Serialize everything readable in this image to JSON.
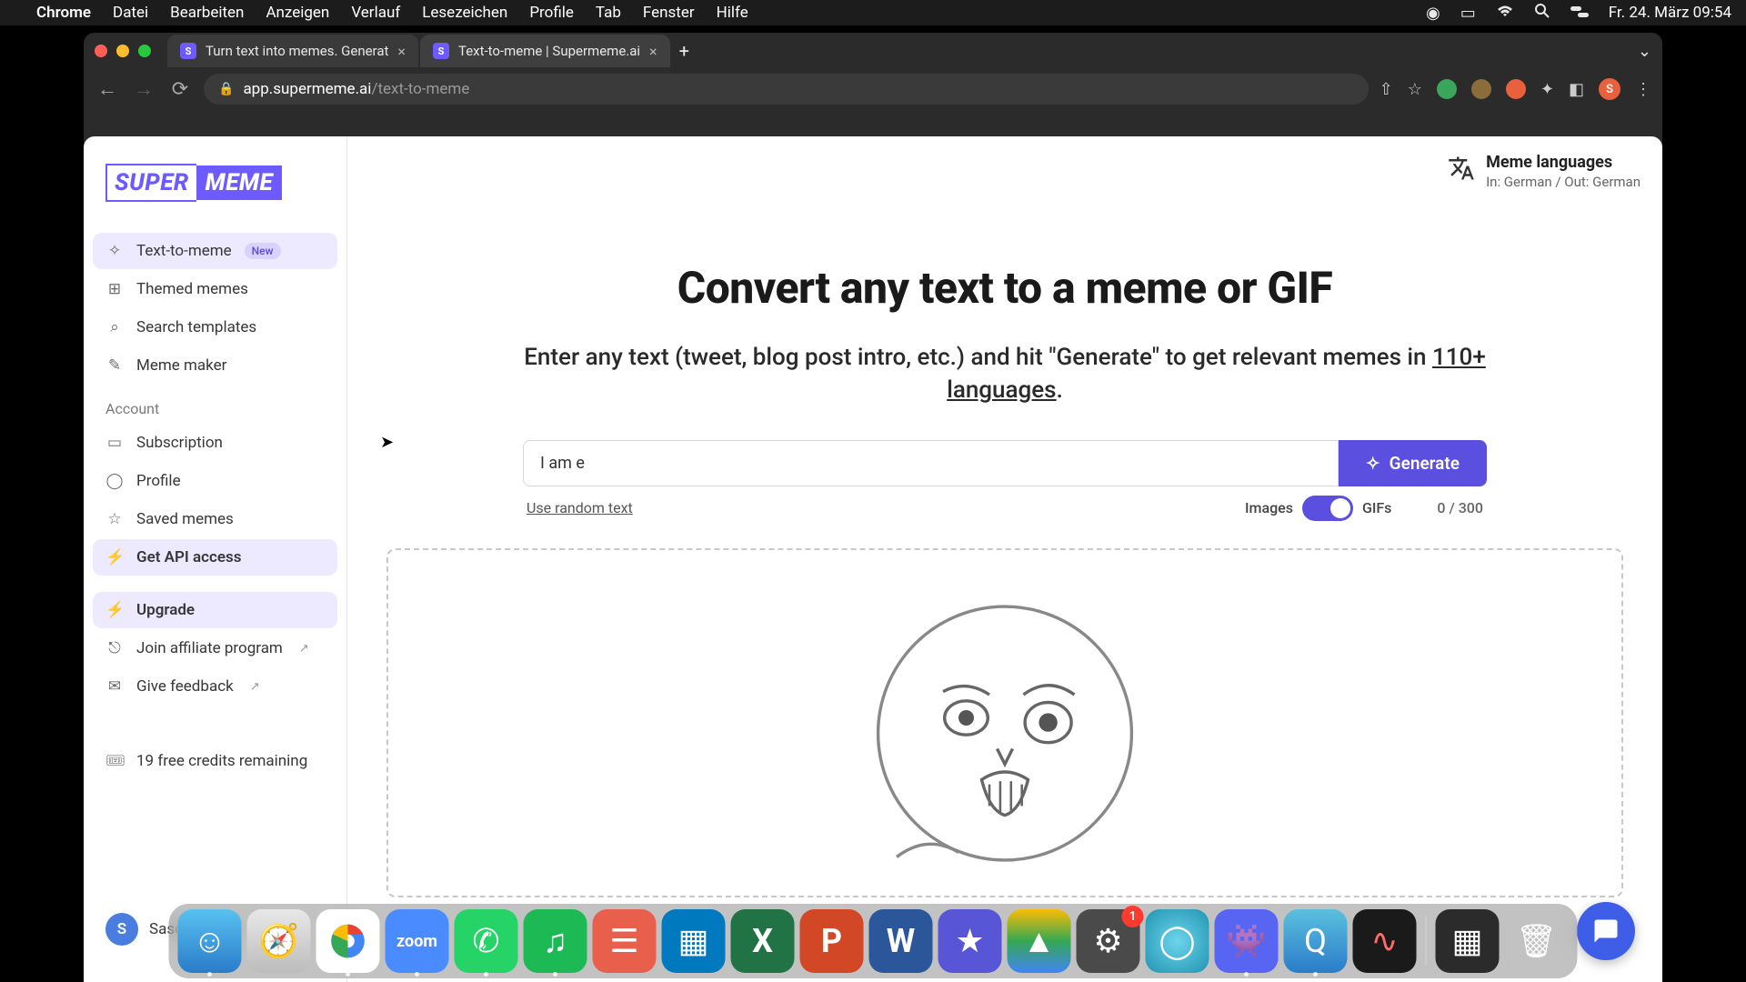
{
  "menubar": {
    "app": "Chrome",
    "items": [
      "Datei",
      "Bearbeiten",
      "Anzeigen",
      "Verlauf",
      "Lesezeichen",
      "Profile",
      "Tab",
      "Fenster",
      "Hilfe"
    ],
    "clock": "Fr. 24. März  09:54"
  },
  "browser": {
    "tabs": [
      {
        "title": "Turn text into memes. Generat",
        "favicon": "S"
      },
      {
        "title": "Text-to-meme | Supermeme.ai",
        "favicon": "S"
      }
    ],
    "url_domain": "app.supermeme.ai",
    "url_path": "/text-to-meme",
    "avatar_letter": "S"
  },
  "logo": {
    "left": "SUPER",
    "right": "MEME"
  },
  "sidebar": {
    "nav": [
      {
        "label": "Text-to-meme",
        "badge": "New",
        "active": true
      },
      {
        "label": "Themed memes"
      },
      {
        "label": "Search templates"
      },
      {
        "label": "Meme maker"
      }
    ],
    "account_label": "Account",
    "account": [
      {
        "label": "Subscription"
      },
      {
        "label": "Profile"
      },
      {
        "label": "Saved memes"
      },
      {
        "label": "Get API access",
        "highlight": true
      }
    ],
    "extras": [
      {
        "label": "Upgrade",
        "highlight": true
      },
      {
        "label": "Join affiliate program",
        "ext": true
      },
      {
        "label": "Give feedback",
        "ext": true
      }
    ],
    "credits": "19 free credits remaining",
    "user": {
      "initial": "S",
      "name": "Sascha Delp"
    }
  },
  "lang": {
    "title": "Meme languages",
    "sub": "In: German / Out: German"
  },
  "hero": {
    "title": "Convert any text to a meme or GIF",
    "subtitle_1": "Enter any text (tweet, blog post intro, etc.) and hit \"Generate\" to get relevant memes in ",
    "subtitle_link": "110+ languages",
    "subtitle_2": "."
  },
  "input": {
    "value": "I am e",
    "generate": "Generate",
    "random": "Use random text",
    "toggle_left": "Images",
    "toggle_right": "GIFs",
    "counter": "0 / 300"
  },
  "dock": {
    "badge_settings": "1"
  }
}
